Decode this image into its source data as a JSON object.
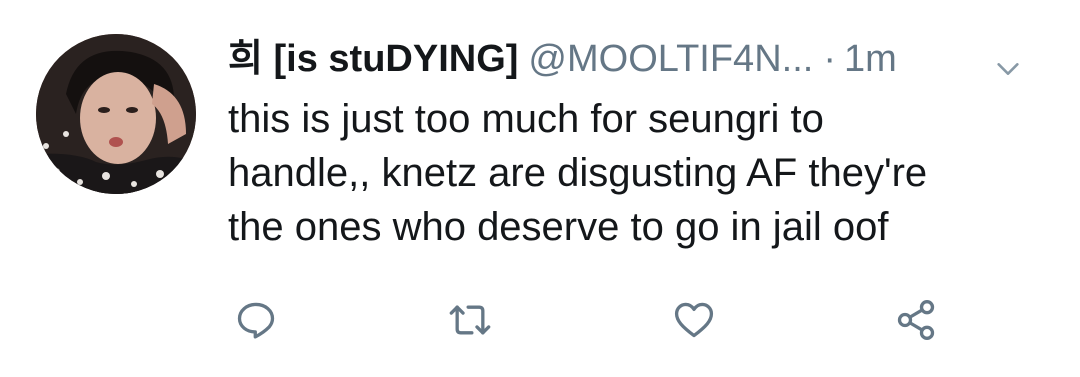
{
  "tweet": {
    "display_name": "희 [is stuDYING]",
    "handle": "@MOOLTIF4N...",
    "separator": "·",
    "time": "1m",
    "body_lines": [
      "this is just too much for seungri to",
      "handle,, knetz are disgusting AF they're",
      "the ones who deserve to go in jail oof"
    ]
  },
  "icons": {
    "caret": "chevron-down-icon",
    "reply": "reply-icon",
    "retweet": "retweet-icon",
    "like": "heart-icon",
    "share": "share-icon"
  },
  "colors": {
    "text": "#14171a",
    "secondary": "#657786",
    "icon": "#657786",
    "background": "#ffffff"
  }
}
